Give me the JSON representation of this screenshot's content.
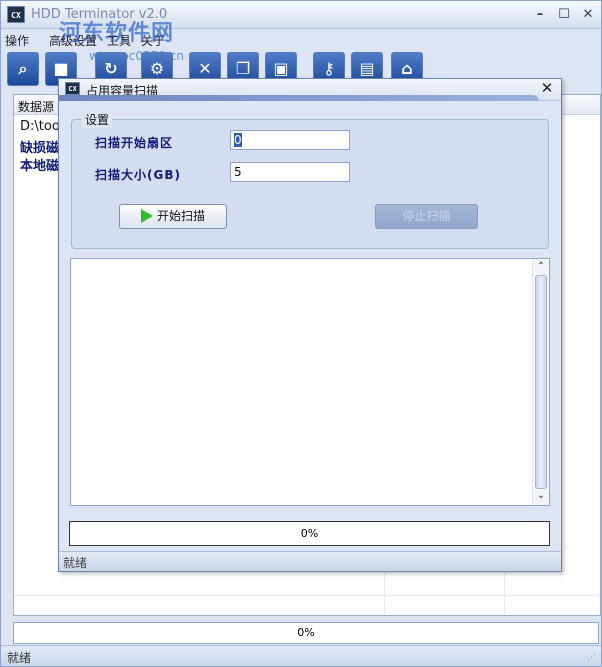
{
  "main": {
    "title": "HDD Terminator v2.0",
    "watermark": "河东软件网",
    "watermark_url": "www.pc0359.cn",
    "menu": [
      "操作",
      "高级设置",
      "工具",
      "关于"
    ],
    "toolbar_icons": [
      "search-icon",
      "stop-icon",
      "refresh-icon",
      "settings-icon",
      "delete-icon",
      "copy-icon",
      "computer-icon",
      "key-icon",
      "document-icon",
      "home-icon"
    ],
    "list_header": "数据源",
    "list_rows": [
      "D:\\too",
      "缺损磁",
      "本地磁"
    ],
    "progress": "0%",
    "status": "就绪"
  },
  "dialog": {
    "title": "占用容量扫描",
    "group_label": "设置",
    "start_sector_label": "扫描开始扇区",
    "start_sector_value": "0",
    "scan_size_label": "扫描大小(GB)",
    "scan_size_value": "5",
    "start_button": "开始扫描",
    "stop_button": "停止扫描",
    "progress": "0%",
    "status": "就绪"
  }
}
